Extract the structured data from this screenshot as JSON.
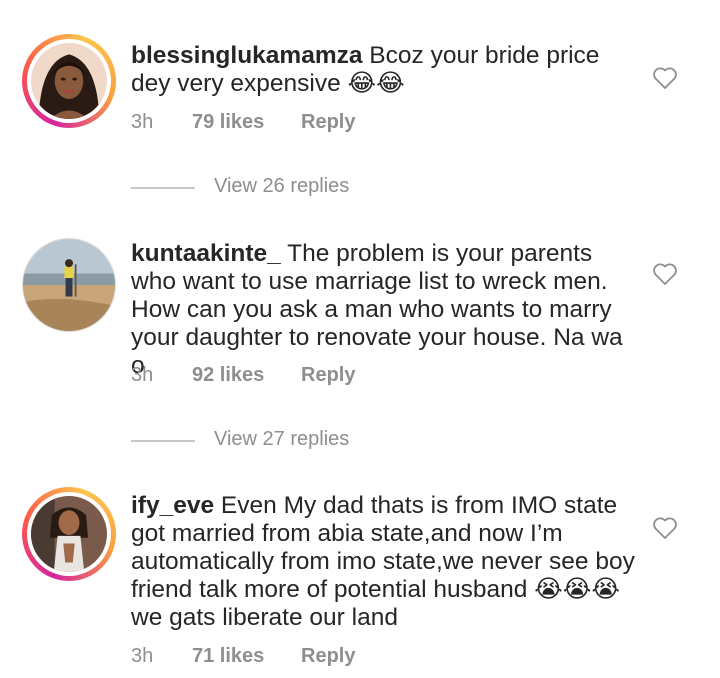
{
  "comments": [
    {
      "username": "blessinglukamamza",
      "text": " Bcoz your bride price dey very expensive 😂😂",
      "time": "3h",
      "likes": "79 likes",
      "reply": "Reply",
      "view_replies": "View 26 replies"
    },
    {
      "username": "kuntaakinte_",
      "text": " The problem is your parents who want to use marriage list to wreck  men. How can you ask a man who wants to marry your daughter to renovate your house. Na wa o",
      "time": "3h",
      "likes": "92 likes",
      "reply": "Reply",
      "view_replies": "View 27 replies"
    },
    {
      "username": "ify_eve",
      "text": " Even My dad thats is from IMO state got married from abia state,and now I’m automatically from imo state,we never see boy friend talk more of potential husband 😭😭😭we gats liberate our land",
      "time": "3h",
      "likes": "71 likes",
      "reply": "Reply"
    }
  ]
}
